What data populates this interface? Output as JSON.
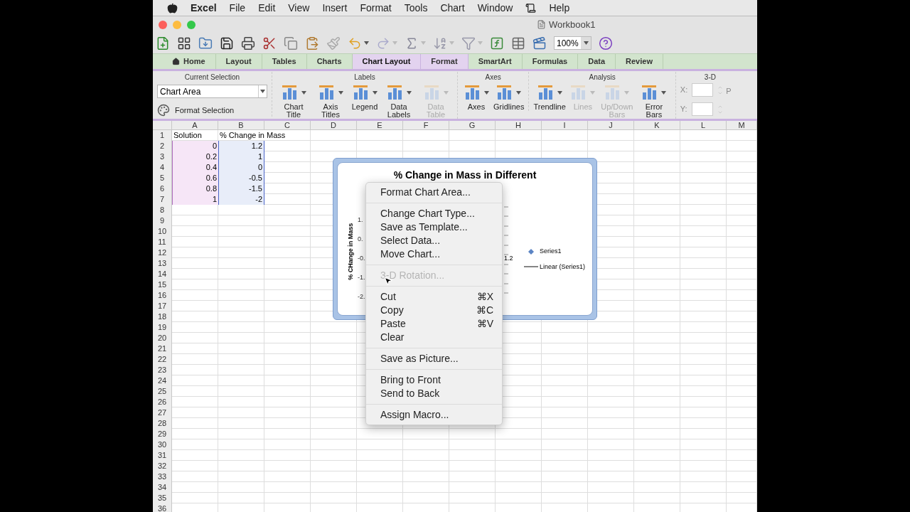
{
  "menu_bar": {
    "app": "Excel",
    "items": [
      "File",
      "Edit",
      "View",
      "Insert",
      "Format",
      "Tools",
      "Chart",
      "Window",
      "Help"
    ]
  },
  "window": {
    "title": "Workbook1"
  },
  "toolbar": {
    "zoom": "100%"
  },
  "ribbon_tabs": [
    {
      "label": "Home",
      "selected": false,
      "contextual": false
    },
    {
      "label": "Layout",
      "selected": false,
      "contextual": false
    },
    {
      "label": "Tables",
      "selected": false,
      "contextual": false
    },
    {
      "label": "Charts",
      "selected": false,
      "contextual": false
    },
    {
      "label": "Chart Layout",
      "selected": true,
      "contextual": true
    },
    {
      "label": "Format",
      "selected": false,
      "contextual": true
    },
    {
      "label": "SmartArt",
      "selected": false,
      "contextual": false
    },
    {
      "label": "Formulas",
      "selected": false,
      "contextual": false
    },
    {
      "label": "Data",
      "selected": false,
      "contextual": false
    },
    {
      "label": "Review",
      "selected": false,
      "contextual": false
    }
  ],
  "ribbon_groups": [
    {
      "title": "Current Selection",
      "kind": "selection",
      "dropdown": "Chart Area",
      "button": "Format Selection"
    },
    {
      "title": "Labels",
      "kind": "buttons",
      "buttons": [
        {
          "label": "Chart Title",
          "disabled": false
        },
        {
          "label": "Axis Titles",
          "disabled": false
        },
        {
          "label": "Legend",
          "disabled": false
        },
        {
          "label": "Data Labels",
          "disabled": false
        },
        {
          "label": "Data Table",
          "disabled": true
        }
      ]
    },
    {
      "title": "Axes",
      "kind": "buttons",
      "buttons": [
        {
          "label": "Axes",
          "disabled": false
        },
        {
          "label": "Gridlines",
          "disabled": false
        }
      ]
    },
    {
      "title": "Analysis",
      "kind": "buttons",
      "buttons": [
        {
          "label": "Trendline",
          "disabled": false
        },
        {
          "label": "Lines",
          "disabled": true
        },
        {
          "label": "Up/Down Bars",
          "disabled": true
        },
        {
          "label": "Error Bars",
          "disabled": false
        }
      ]
    },
    {
      "title": "3-D",
      "kind": "position",
      "fields": [
        "X:",
        "Y:"
      ],
      "cut_label": "P"
    }
  ],
  "sheet": {
    "columns": [
      "A",
      "B",
      "C",
      "D",
      "E",
      "F",
      "G",
      "H",
      "I",
      "J",
      "K",
      "L",
      "M"
    ],
    "rows": [
      {
        "number": "1",
        "cells": [
          "Solution",
          "% Change in Mass"
        ],
        "highlighted": false
      },
      {
        "number": "2",
        "cells": [
          "0",
          "1.2"
        ],
        "highlighted": true
      },
      {
        "number": "3",
        "cells": [
          "0.2",
          "1"
        ],
        "highlighted": true
      },
      {
        "number": "4",
        "cells": [
          "0.4",
          "0"
        ],
        "highlighted": true
      },
      {
        "number": "5",
        "cells": [
          "0.6",
          "-0.5"
        ],
        "highlighted": true
      },
      {
        "number": "6",
        "cells": [
          "0.8",
          "-1.5"
        ],
        "highlighted": true
      },
      {
        "number": "7",
        "cells": [
          "1",
          "-2"
        ],
        "highlighted": true
      },
      {
        "number": "8",
        "highlighted": false
      },
      {
        "number": "9",
        "highlighted": false
      },
      {
        "number": "10",
        "highlighted": false
      },
      {
        "number": "11",
        "highlighted": false
      },
      {
        "number": "12",
        "highlighted": false
      },
      {
        "number": "13",
        "highlighted": false
      },
      {
        "number": "14",
        "highlighted": false
      },
      {
        "number": "15",
        "highlighted": false
      },
      {
        "number": "16",
        "highlighted": false
      },
      {
        "number": "17",
        "highlighted": false
      },
      {
        "number": "18",
        "highlighted": false
      },
      {
        "number": "19",
        "highlighted": false
      },
      {
        "number": "20",
        "highlighted": false
      },
      {
        "number": "21",
        "highlighted": false
      },
      {
        "number": "22",
        "highlighted": false
      },
      {
        "number": "23",
        "highlighted": false
      },
      {
        "number": "24",
        "highlighted": false
      },
      {
        "number": "25",
        "highlighted": false
      },
      {
        "number": "26",
        "highlighted": false
      },
      {
        "number": "27",
        "highlighted": false
      },
      {
        "number": "28",
        "highlighted": false
      },
      {
        "number": "29",
        "highlighted": false
      },
      {
        "number": "30",
        "highlighted": false
      },
      {
        "number": "31",
        "highlighted": false
      },
      {
        "number": "32",
        "highlighted": false
      },
      {
        "number": "33",
        "highlighted": false
      },
      {
        "number": "34",
        "highlighted": false
      },
      {
        "number": "35",
        "highlighted": false
      },
      {
        "number": "36",
        "highlighted": false
      }
    ]
  },
  "chart": {
    "title": "% Change in Mass in Different",
    "y_axis_title": "% CHange in Mass",
    "y_tick_labels": [
      "1.",
      "0.",
      "-0.",
      "-1.",
      "-2."
    ],
    "data_label": "1.2",
    "legend": [
      {
        "label": "Series1",
        "kind": "marker"
      },
      {
        "label": "Linear (Series1)",
        "kind": "line"
      }
    ]
  },
  "context_menu": {
    "groups": [
      {
        "items": [
          {
            "label": "Format Chart Area...",
            "disabled": false
          }
        ]
      },
      {
        "items": [
          {
            "label": "Change Chart Type...",
            "disabled": false
          },
          {
            "label": "Save as Template...",
            "disabled": false
          },
          {
            "label": "Select Data...",
            "disabled": false
          },
          {
            "label": "Move Chart...",
            "disabled": false
          }
        ]
      },
      {
        "items": [
          {
            "label": "3-D Rotation...",
            "disabled": true
          }
        ]
      },
      {
        "items": [
          {
            "label": "Cut",
            "shortcut": "⌘X",
            "disabled": false
          },
          {
            "label": "Copy",
            "shortcut": "⌘C",
            "disabled": false
          },
          {
            "label": "Paste",
            "shortcut": "⌘V",
            "disabled": false
          },
          {
            "label": "Clear",
            "disabled": false
          }
        ]
      },
      {
        "items": [
          {
            "label": "Save as Picture...",
            "disabled": false
          }
        ]
      },
      {
        "items": [
          {
            "label": "Bring to Front",
            "disabled": false
          },
          {
            "label": "Send to Back",
            "disabled": false
          }
        ]
      },
      {
        "items": [
          {
            "label": "Assign Macro...",
            "disabled": false
          }
        ]
      }
    ]
  }
}
